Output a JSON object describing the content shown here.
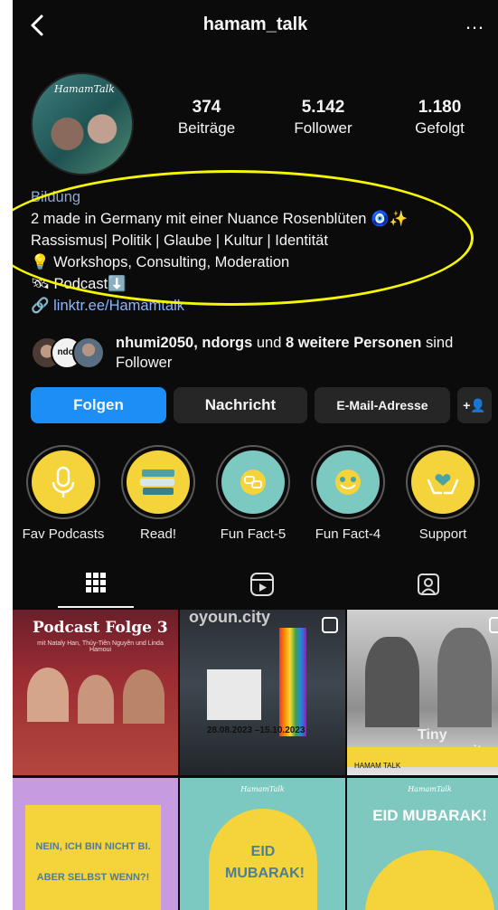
{
  "header": {
    "title": "hamam_talk",
    "back_icon": "chevron-left-icon",
    "more_label": "…"
  },
  "profile": {
    "avatar_text": "HamamTalk",
    "stats": [
      {
        "value": "374",
        "label": "Beiträge"
      },
      {
        "value": "5.142",
        "label": "Follower"
      },
      {
        "value": "1.180",
        "label": "Gefolgt"
      }
    ],
    "bio": {
      "category": "Bildung",
      "lines": [
        "2 made in Germany mit einer Nuance Rosenblüten 🧿✨",
        "Rassismus| Politik | Glaube | Kultur | Identität",
        "💡 Workshops, Consulting, Moderation",
        "🛰 Podcast⬇️"
      ],
      "link": "linktr.ee/Hamamtalk"
    }
  },
  "mutual_followers": {
    "names": "nhumi2050, ndorgs",
    "connector": " und ",
    "count_text": "8 weitere Personen",
    "suffix": " sind Follower",
    "mini_avatar_text": "ndo."
  },
  "actions": {
    "follow": "Folgen",
    "message": "Nachricht",
    "email": "E-Mail-Adresse",
    "add_person": "+👤"
  },
  "highlights": [
    {
      "label": "Fav Podcasts",
      "icon": "microphone-icon"
    },
    {
      "label": "Read!",
      "icon": "books-icon"
    },
    {
      "label": "Fun Fact-5",
      "icon": "speech-bubbles-icon"
    },
    {
      "label": "Fun Fact-4",
      "icon": "smile-icon"
    },
    {
      "label": "Support",
      "icon": "heart-hands-icon"
    }
  ],
  "tabs": [
    {
      "name": "grid",
      "glyph": "▦"
    },
    {
      "name": "reels",
      "glyph": "▶"
    },
    {
      "name": "tagged",
      "glyph": "☺"
    }
  ],
  "posts": [
    {
      "text": "Podcast Folge 3",
      "subtext": "mit Nataly Han, Thúy-Tiên Nguyên und Linda Hamoui"
    },
    {
      "text": "oyoun.city",
      "subtext": "28.08.2023 –15.10.2023"
    },
    {
      "text": "Tiny oyoun.city",
      "subtext": "HAMAM TALK"
    },
    {
      "text": "NEIN, ICH BIN NICHT BI.",
      "subtext": "ABER SELBST WENN?!"
    },
    {
      "text": "EID MUBARAK!",
      "subtext": "HamamTalk"
    },
    {
      "text": "EID MUBARAK!",
      "subtext": "HamamTalk"
    }
  ],
  "colors": {
    "background": "#0b0b0b",
    "follow_button": "#1d8ef5",
    "link": "#8db5ff",
    "annotation": "#f6f600"
  }
}
